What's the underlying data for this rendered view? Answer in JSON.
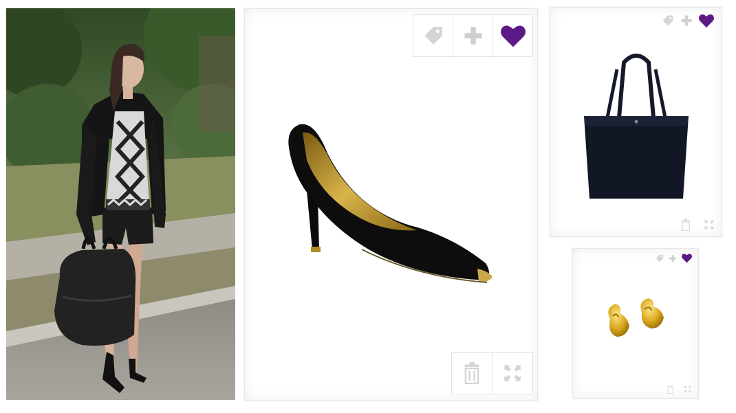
{
  "outfit": {
    "image": "street-style-outfit-photo"
  },
  "products": [
    {
      "item": "black-suede-pump",
      "controls": [
        "tag-icon",
        "plus-icon",
        "heart-icon",
        "trash-icon",
        "expand-icon"
      ]
    },
    {
      "item": "black-leather-tote-bag",
      "controls": [
        "tag-icon",
        "plus-icon",
        "heart-icon",
        "trash-icon",
        "expand-icon"
      ]
    },
    {
      "item": "gold-stud-earrings",
      "controls": [
        "tag-icon",
        "plus-icon",
        "heart-icon",
        "trash-icon",
        "expand-icon"
      ]
    }
  ],
  "colors": {
    "heart_active": "#5b1a86",
    "icon_inactive": "#cfcfcf",
    "card_border": "#e6e6e6"
  }
}
